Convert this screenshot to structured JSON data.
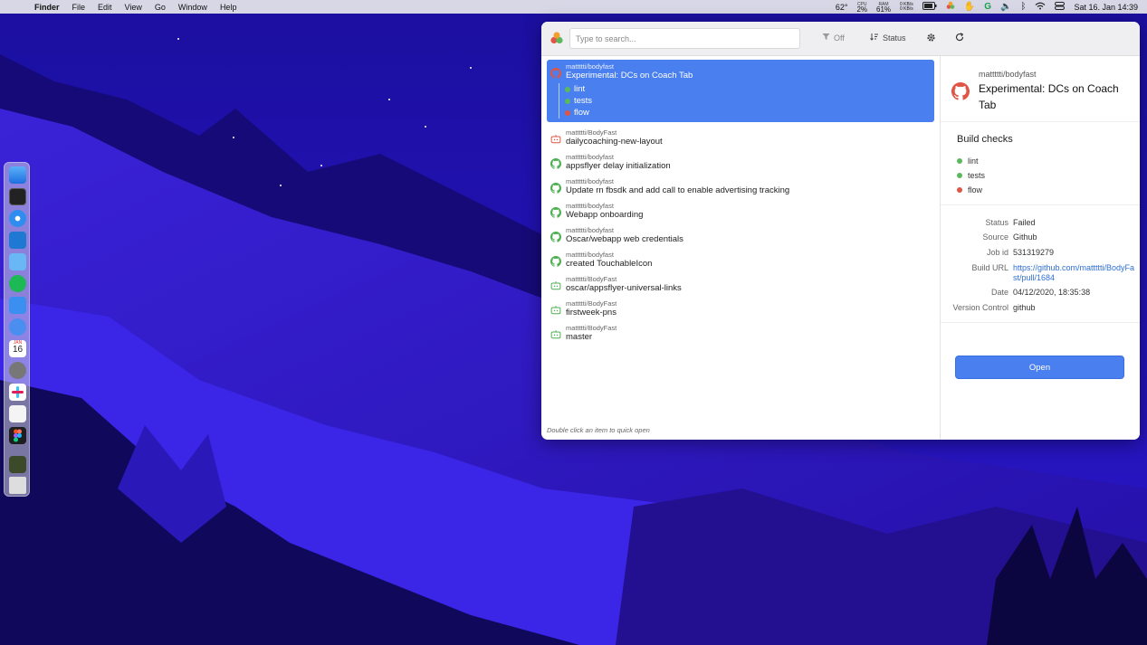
{
  "menubar": {
    "app": "Finder",
    "menus": [
      "File",
      "Edit",
      "View",
      "Go",
      "Window",
      "Help"
    ],
    "temp": "62°",
    "cpu_label": "CPU",
    "cpu_value": "2%",
    "ram_label": "RAM",
    "ram_value": "61%",
    "net_up": "0 KB/s",
    "net_down": "0 KB/s",
    "datetime": "Sat 16. Jan  14:39"
  },
  "dock": {
    "calendar_day": "16",
    "calendar_month": "JAN"
  },
  "toolbar": {
    "search_placeholder": "Type to search...",
    "filter_label": "Off",
    "sort_label": "Status"
  },
  "colors": {
    "accent": "#4a7ff0",
    "success": "#5cb85c",
    "failure": "#e05545",
    "github_green": "#4caf50"
  },
  "builds": [
    {
      "repo": "mattttti/bodyfast",
      "title": "Experimental: DCs on Coach Tab",
      "icon": "github-icon",
      "status": "failed",
      "selected": true,
      "checks": [
        {
          "name": "lint",
          "status": "success"
        },
        {
          "name": "tests",
          "status": "success"
        },
        {
          "name": "flow",
          "status": "failed"
        }
      ]
    },
    {
      "repo": "mattttti/BodyFast",
      "title": "dailycoaching-new-layout",
      "icon": "bitrise-icon",
      "status": "failed"
    },
    {
      "repo": "mattttti/bodyfast",
      "title": "appsflyer delay initialization",
      "icon": "github-icon",
      "status": "success"
    },
    {
      "repo": "mattttti/bodyfast",
      "title": "Update rn fbsdk and add call to enable advertising tracking",
      "icon": "github-icon",
      "status": "success"
    },
    {
      "repo": "mattttti/bodyfast",
      "title": "Webapp onboarding",
      "icon": "github-icon",
      "status": "success"
    },
    {
      "repo": "mattttti/bodyfast",
      "title": "Oscar/webapp web credentials",
      "icon": "github-icon",
      "status": "success"
    },
    {
      "repo": "mattttti/bodyfast",
      "title": "created TouchableIcon",
      "icon": "github-icon",
      "status": "success"
    },
    {
      "repo": "mattttti/BodyFast",
      "title": "oscar/appsflyer-universal-links",
      "icon": "bitrise-icon",
      "status": "success"
    },
    {
      "repo": "mattttti/BodyFast",
      "title": "firstweek-pns",
      "icon": "bitrise-icon",
      "status": "success"
    },
    {
      "repo": "mattttti/BodyFast",
      "title": "master",
      "icon": "bitrise-icon",
      "status": "success"
    }
  ],
  "hint": "Double click an item to quick open",
  "detail": {
    "repo": "mattttti/bodyfast",
    "title": "Experimental: DCs on Coach Tab",
    "checks_heading": "Build checks",
    "checks": [
      {
        "name": "lint",
        "status": "success"
      },
      {
        "name": "tests",
        "status": "success"
      },
      {
        "name": "flow",
        "status": "failed"
      }
    ],
    "info": [
      {
        "label": "Status",
        "value": "Failed"
      },
      {
        "label": "Source",
        "value": "Github"
      },
      {
        "label": "Job id",
        "value": "531319279"
      },
      {
        "label": "Build URL",
        "value": "https://github.com/mattttti/BodyFast/pull/1684",
        "link": true
      },
      {
        "label": "Date",
        "value": "04/12/2020, 18:35:38"
      },
      {
        "label": "Version Control",
        "value": "github"
      }
    ],
    "open_label": "Open"
  }
}
